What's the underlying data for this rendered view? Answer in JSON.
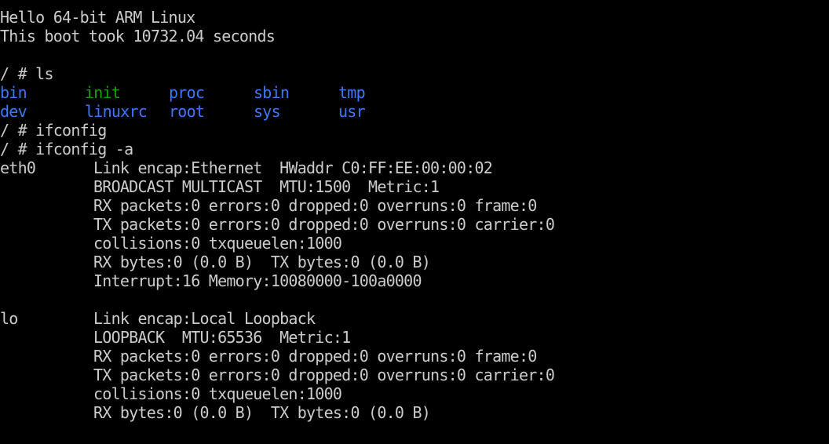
{
  "terminal": {
    "banner_1": "Hello 64-bit ARM Linux",
    "banner_2": "This boot took 10732.04 seconds",
    "cmd_ls": "/ # ls",
    "ls_row1": [
      "bin",
      "init",
      "proc",
      "sbin",
      "tmp"
    ],
    "ls_row2": [
      "dev",
      "linuxrc",
      "root",
      "sys",
      "usr"
    ],
    "cmd_ifconfig": "/ # ifconfig",
    "cmd_ifconfig_a": "/ # ifconfig -a",
    "eth0": {
      "name": "eth0",
      "lines": [
        "Link encap:Ethernet  HWaddr C0:FF:EE:00:00:02",
        "BROADCAST MULTICAST  MTU:1500  Metric:1",
        "RX packets:0 errors:0 dropped:0 overruns:0 frame:0",
        "TX packets:0 errors:0 dropped:0 overruns:0 carrier:0",
        "collisions:0 txqueuelen:1000",
        "RX bytes:0 (0.0 B)  TX bytes:0 (0.0 B)",
        "Interrupt:16 Memory:10080000-100a0000"
      ]
    },
    "lo": {
      "name": "lo",
      "lines": [
        "Link encap:Local Loopback",
        "LOOPBACK  MTU:65536  Metric:1",
        "RX packets:0 errors:0 dropped:0 overruns:0 frame:0",
        "TX packets:0 errors:0 dropped:0 overruns:0 carrier:0",
        "collisions:0 txqueuelen:1000",
        "RX bytes:0 (0.0 B)  TX bytes:0 (0.0 B)"
      ]
    },
    "prompt": "/ #"
  },
  "colors": {
    "background": "#000000",
    "foreground": "#cccccc",
    "directory": "#3b78ff",
    "executable": "#13a10e",
    "symlink": "#3b78ff"
  }
}
